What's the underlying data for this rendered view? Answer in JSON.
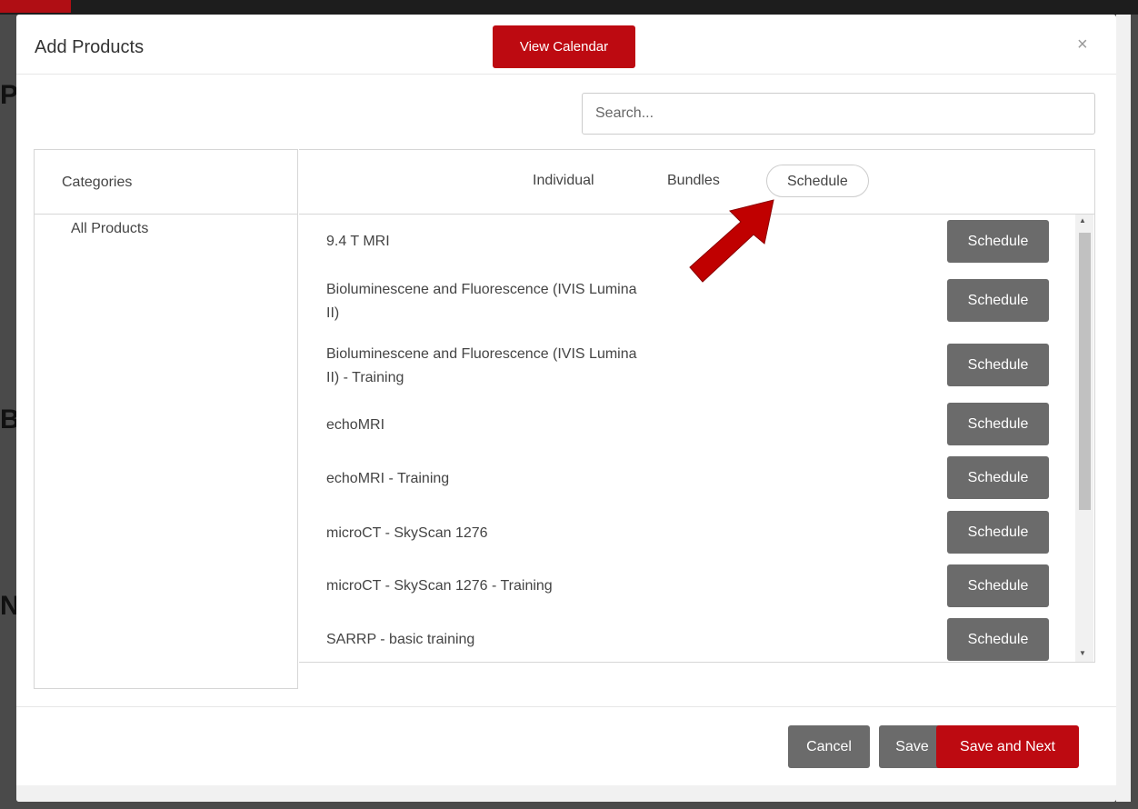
{
  "modal": {
    "title": "Add Products",
    "view_calendar_label": "View Calendar",
    "close_glyph": "×"
  },
  "search": {
    "placeholder": "Search..."
  },
  "categories": {
    "header": "Categories",
    "items": [
      "All Products"
    ]
  },
  "tabs": [
    {
      "label": "Individual",
      "active": false
    },
    {
      "label": "Bundles",
      "active": false
    },
    {
      "label": "Schedule",
      "active": true
    }
  ],
  "products": [
    {
      "name": "9.4 T MRI",
      "action": "Schedule"
    },
    {
      "name": "Bioluminescene and Fluorescence (IVIS Lumina II)",
      "action": "Schedule"
    },
    {
      "name": "Bioluminescene and Fluorescence (IVIS Lumina II) - Training",
      "action": "Schedule"
    },
    {
      "name": "echoMRI",
      "action": "Schedule"
    },
    {
      "name": "echoMRI - Training",
      "action": "Schedule"
    },
    {
      "name": "microCT - SkyScan 1276",
      "action": "Schedule"
    },
    {
      "name": "microCT - SkyScan 1276 - Training",
      "action": "Schedule"
    },
    {
      "name": "SARRP - basic training",
      "action": "Schedule"
    }
  ],
  "footer": {
    "cancel_label": "Cancel",
    "save_label": "Save",
    "save_next_label": "Save and Next"
  },
  "colors": {
    "brand_red": "#bd0a11",
    "button_grey": "#6b6b6b",
    "annotation_arrow": "#c00000"
  },
  "icons": {
    "close": "close-icon",
    "annotation": "annotation-arrow-icon"
  }
}
